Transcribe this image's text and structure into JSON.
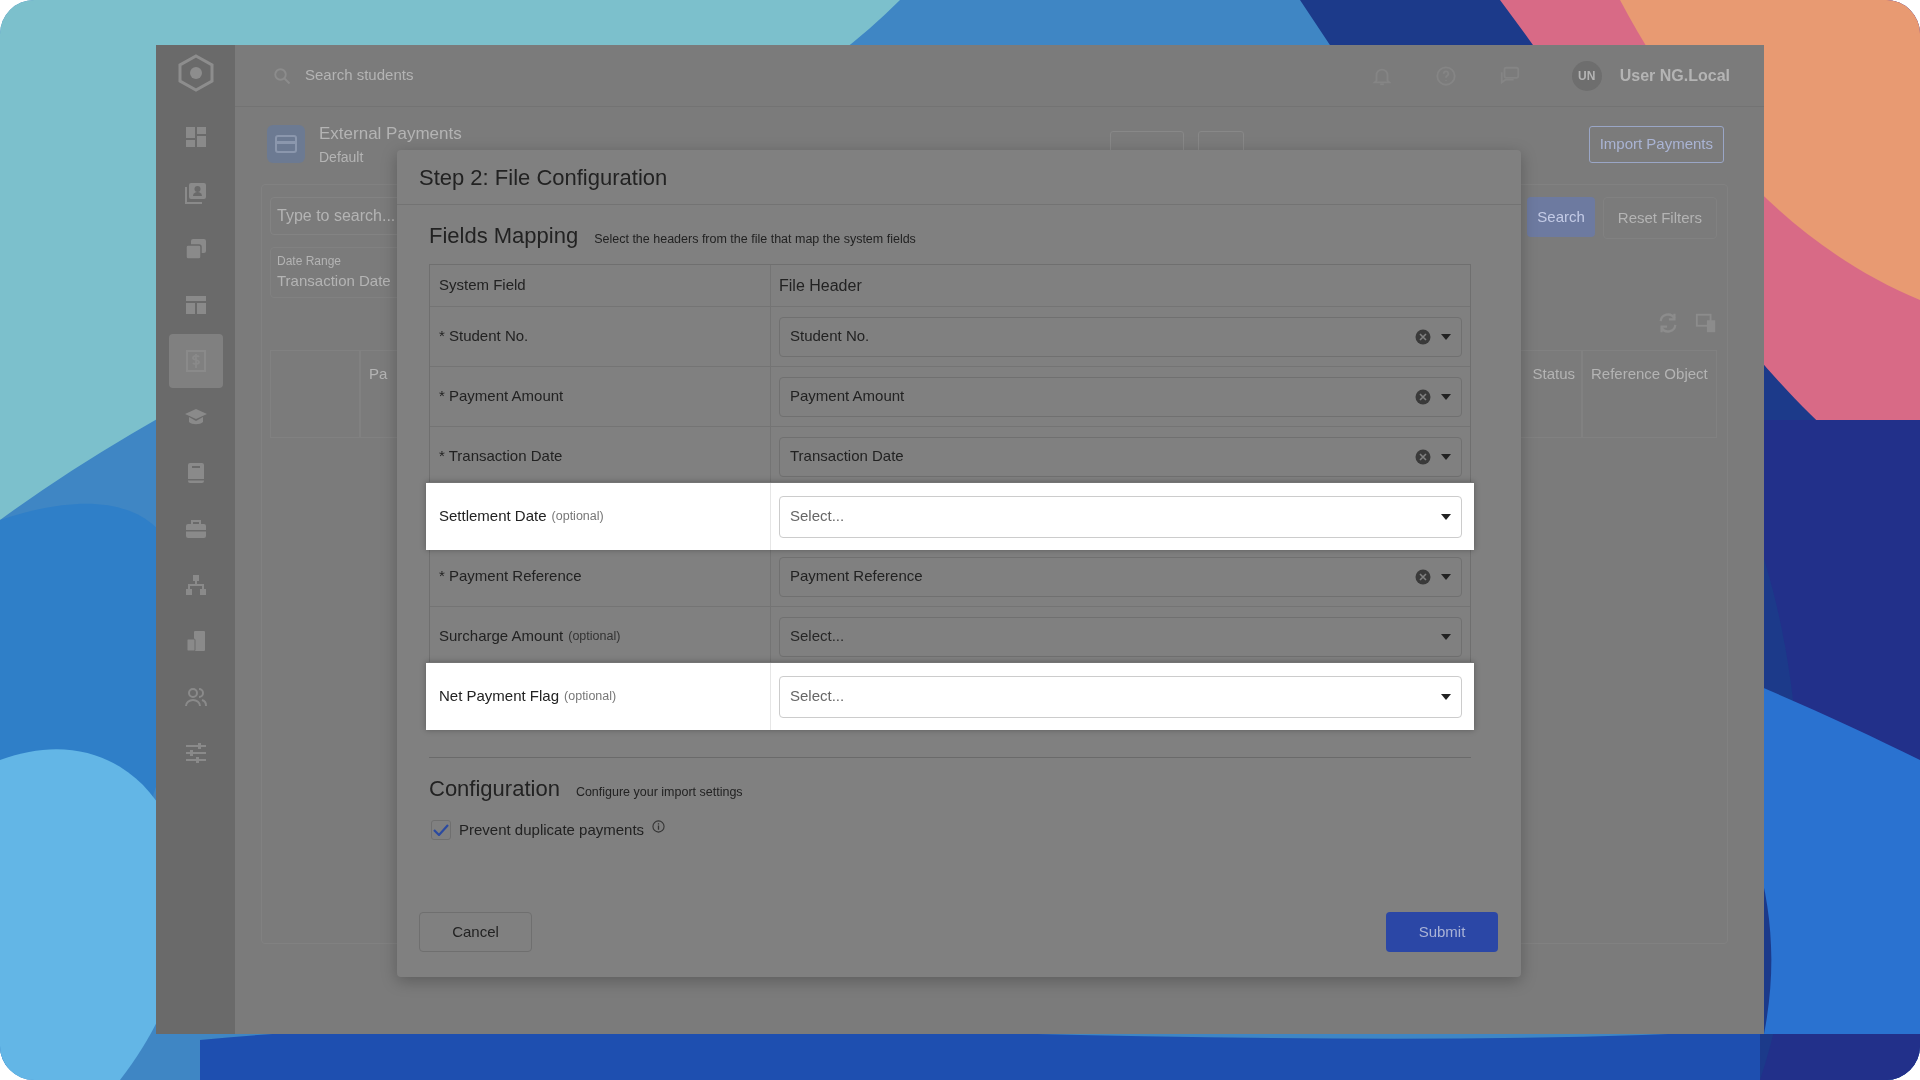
{
  "app": {
    "search_placeholder": "Search students",
    "user": {
      "initials": "UN",
      "name": "User NG.Local"
    },
    "sidebar": [
      {
        "selected": false
      },
      {
        "selected": false
      },
      {
        "selected": false
      },
      {
        "selected": false
      },
      {
        "selected": true
      },
      {
        "selected": false
      },
      {
        "selected": false
      },
      {
        "selected": false
      },
      {
        "selected": false
      },
      {
        "selected": false
      },
      {
        "selected": false
      },
      {
        "selected": false
      }
    ]
  },
  "page": {
    "title": "External Payments",
    "subtitle": "Default",
    "import_button": "Import Payments",
    "search_placeholder": "Type to search...",
    "date_range": {
      "label": "Date Range",
      "value": "Transaction Date"
    },
    "search_button": "Search",
    "reset_button": "Reset Filters",
    "table_columns": [
      "Pa",
      "Status",
      "Reference Object"
    ]
  },
  "modal": {
    "title": "Step 2: File Configuration",
    "mapping": {
      "title": "Fields Mapping",
      "subtitle": "Select the headers from the file that map the system fields",
      "columns": [
        "System Field",
        "File Header"
      ],
      "rows": [
        {
          "field": "* Student No.",
          "value": "Student No.",
          "highlighted": false
        },
        {
          "field": "* Payment Amount",
          "value": "Payment Amount",
          "highlighted": false
        },
        {
          "field": "* Transaction Date",
          "value": "Transaction Date",
          "highlighted": false
        },
        {
          "field": "Settlement Date",
          "note": "(optional)",
          "placeholder": "Select...",
          "highlighted": true
        },
        {
          "field": "* Payment Reference",
          "value": "Payment Reference",
          "highlighted": false
        },
        {
          "field": "Surcharge Amount",
          "note": "(optional)",
          "placeholder": "Select...",
          "highlighted": false
        },
        {
          "field": "Net Payment Flag",
          "note": "(optional)",
          "placeholder": "Select...",
          "highlighted": true
        }
      ]
    },
    "configuration": {
      "title": "Configuration",
      "subtitle": "Configure your import settings",
      "checkbox": {
        "label": "Prevent duplicate payments",
        "checked": true
      }
    },
    "cancel_button": "Cancel",
    "submit_button": "Submit"
  }
}
